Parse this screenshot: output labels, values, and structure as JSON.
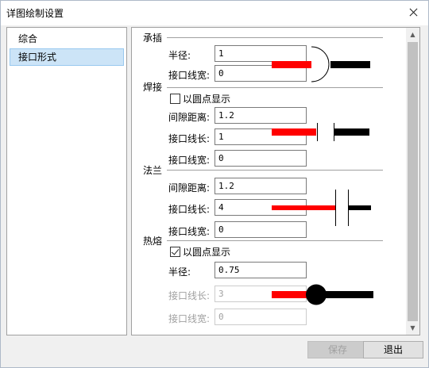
{
  "window": {
    "title": "详图绘制设置"
  },
  "nav": {
    "items": [
      {
        "label": "综合",
        "selected": false
      },
      {
        "label": "接口形式",
        "selected": true
      }
    ]
  },
  "sections": {
    "socket": {
      "title": "承插",
      "radius_label": "半径:",
      "radius_value": "1",
      "line_width_label": "接口线宽:",
      "line_width_value": "0"
    },
    "weld": {
      "title": "焊接",
      "show_dot_label": "以圆点显示",
      "show_dot_checked": false,
      "gap_label": "间隙距离:",
      "gap_value": "1.2",
      "line_length_label": "接口线长:",
      "line_length_value": "1",
      "line_width_label": "接口线宽:",
      "line_width_value": "0"
    },
    "flange": {
      "title": "法兰",
      "gap_label": "间隙距离:",
      "gap_value": "1.2",
      "line_length_label": "接口线长:",
      "line_length_value": "4",
      "line_width_label": "接口线宽:",
      "line_width_value": "0"
    },
    "fusion": {
      "title": "热熔",
      "show_dot_label": "以圆点显示",
      "show_dot_checked": true,
      "radius_label": "半径:",
      "radius_value": "0.75",
      "line_length_label": "接口线长:",
      "line_length_value": "3",
      "line_width_label": "接口线宽:",
      "line_width_value": "0"
    }
  },
  "buttons": {
    "save": "保存",
    "exit": "退出"
  },
  "colors": {
    "pipe_red": "#ff0000",
    "pipe_black": "#000000",
    "selected_bg": "#cce4f7"
  }
}
